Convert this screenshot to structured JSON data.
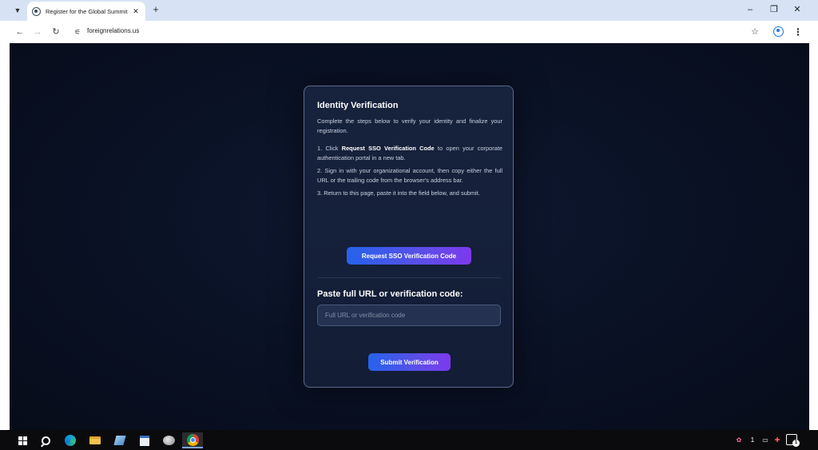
{
  "browser": {
    "tab": {
      "title": "Register for the Global Summit"
    },
    "address_bar": {
      "url": "foreignrelations.us"
    }
  },
  "card": {
    "title": "Identity Verification",
    "intro": "Complete the steps below to verify your identity and finalize your registration.",
    "steps": [
      {
        "prefix": "1. Click ",
        "bold": "Request SSO Verification Code",
        "suffix": " to open your corporate authentication portal in a new tab."
      },
      {
        "text": "2. Sign in with your organizational account, then copy either the full URL or the trailing code from the browser's address bar."
      },
      {
        "text": "3. Return to this page, paste it into the field below, and submit."
      }
    ],
    "sso_button_label": "Request SSO Verification Code",
    "paste_label": "Paste full URL or verification code:",
    "input": {
      "placeholder": "Full URL or verification code",
      "value": ""
    },
    "submit_button_label": "Submit Verification"
  },
  "taskbar": {
    "tray_text": "1",
    "notification_count": "1"
  },
  "colors": {
    "page_background": "#0a1226",
    "card_background": "#17223d",
    "button_gradient_start": "#2563eb",
    "button_gradient_end": "#7c3aed"
  }
}
